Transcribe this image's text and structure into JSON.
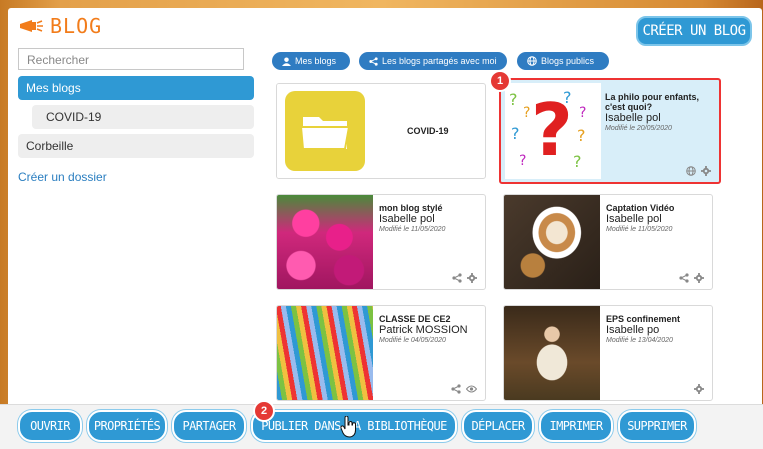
{
  "header": {
    "title": "BLOG",
    "create_button": "CRÉER UN BLOG"
  },
  "sidebar": {
    "search_placeholder": "Rechercher",
    "items": [
      {
        "label": "Mes blogs"
      },
      {
        "label": "COVID-19"
      },
      {
        "label": "Corbeille"
      }
    ],
    "create_folder": "Créer un dossier"
  },
  "filters": {
    "my_blogs": "Mes blogs",
    "shared": "Les blogs partagés avec moi",
    "public": "Blogs publics"
  },
  "folder": {
    "name": "COVID-19"
  },
  "blogs": [
    {
      "title": "La philo pour enfants, c'est quoi?",
      "author": "Isabelle pol",
      "modified": "Modifié le 20/05/2020"
    },
    {
      "title": "mon blog stylé",
      "author": "Isabelle pol",
      "modified": "Modifié le 11/05/2020"
    },
    {
      "title": "Captation Vidéo",
      "author": "Isabelle pol",
      "modified": "Modifié le 11/05/2020"
    },
    {
      "title": "CLASSE DE CE2",
      "author": "Patrick MOSSION",
      "modified": "Modifié le 04/05/2020"
    },
    {
      "title": "EPS confinement",
      "author": "Isabelle po",
      "modified": "Modifié le 13/04/2020"
    }
  ],
  "badges": {
    "one": "1",
    "two": "2"
  },
  "toolbar": {
    "open": "OUVRIR",
    "properties": "PROPRIÉTÉS",
    "share": "PARTAGER",
    "publish": "PUBLIER DANS LA BIBLIOTHÈQUE",
    "move": "DÉPLACER",
    "print": "IMPRIMER",
    "delete": "SUPPRIMER"
  },
  "colors": {
    "accent": "#2f99d4",
    "brand": "#f27c1a",
    "selection": "#e33333"
  }
}
